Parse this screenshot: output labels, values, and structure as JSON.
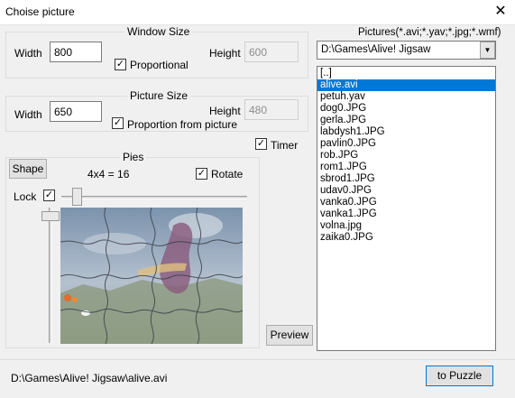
{
  "window": {
    "title": "Choise picture",
    "close_glyph": "✕"
  },
  "window_size": {
    "legend": "Window Size",
    "width_label": "Width",
    "width_value": "800",
    "height_label": "Height",
    "height_value": "600",
    "proportional_label": "Proportional",
    "proportional_checked": true
  },
  "picture_size": {
    "legend": "Picture Size",
    "width_label": "Width",
    "width_value": "650",
    "height_label": "Height",
    "height_value": "480",
    "proportion_label": "Proportion from picture",
    "proportion_checked": true
  },
  "timer": {
    "label": "Timer",
    "checked": true
  },
  "pies": {
    "legend": "Pies",
    "shape_label": "Shape",
    "count_text": "4x4 = 16",
    "rotate_label": "Rotate",
    "rotate_checked": true,
    "lock_label": "Lock",
    "lock_checked": true,
    "grid_rows": 4,
    "grid_cols": 4
  },
  "preview_label": "Preview",
  "pictures": {
    "label": "Pictures(*.avi;*.yav;*.jpg;*.wmf)",
    "folder": "D:\\Games\\Alive! Jigsaw",
    "items": [
      "[..]",
      "alive.avi",
      "petuh.yav",
      "dog0.JPG",
      "gerla.JPG",
      "labdysh1.JPG",
      "pavlin0.JPG",
      "rob.JPG",
      "rom1.JPG",
      "sbrod1.JPG",
      "udav0.JPG",
      "vanka0.JPG",
      "vanka1.JPG",
      "volna.jpg",
      "zaika0.JPG"
    ],
    "selected_index": 1
  },
  "status": {
    "path": "D:\\Games\\Alive! Jigsaw\\alive.avi",
    "to_puzzle_label": "to Puzzle"
  },
  "colors": {
    "selection": "#0078d7",
    "sky": "#8fa7bf",
    "ground": "#7b8a6f"
  }
}
